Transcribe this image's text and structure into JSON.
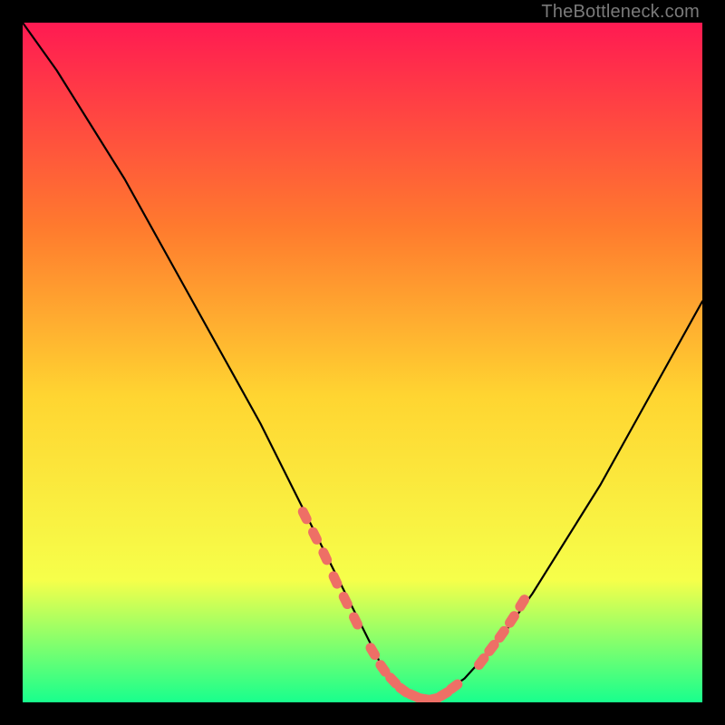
{
  "watermark": "TheBottleneck.com",
  "chart_data": {
    "type": "line",
    "title": "",
    "xlabel": "",
    "ylabel": "",
    "xlim": [
      0,
      100
    ],
    "ylim": [
      0,
      100
    ],
    "grid": false,
    "legend": false,
    "series": [
      {
        "name": "curve",
        "color": "#000000",
        "x": [
          0,
          5,
          10,
          15,
          20,
          25,
          30,
          35,
          40,
          45,
          50,
          52.5,
          55,
          57.5,
          60,
          65,
          70,
          75,
          80,
          85,
          90,
          95,
          100
        ],
        "values": [
          100,
          93,
          85,
          77,
          68,
          59,
          50,
          41,
          31,
          21,
          11,
          6,
          3,
          1,
          0,
          3.5,
          9,
          16,
          24,
          32,
          41,
          50,
          59
        ]
      }
    ],
    "highlight_segments": [
      {
        "name": "left-approach",
        "points": [
          {
            "x": 41.5,
            "y": 27.5
          },
          {
            "x": 43.0,
            "y": 24.5
          },
          {
            "x": 44.5,
            "y": 21.5
          },
          {
            "x": 46.0,
            "y": 18.0
          },
          {
            "x": 47.5,
            "y": 15.0
          },
          {
            "x": 49.0,
            "y": 12.0
          }
        ]
      },
      {
        "name": "valley-floor",
        "points": [
          {
            "x": 51.5,
            "y": 7.5
          },
          {
            "x": 53.0,
            "y": 5.0
          },
          {
            "x": 54.5,
            "y": 3.2
          },
          {
            "x": 56.0,
            "y": 1.8
          },
          {
            "x": 57.5,
            "y": 1.0
          },
          {
            "x": 59.0,
            "y": 0.5
          },
          {
            "x": 60.5,
            "y": 0.5
          },
          {
            "x": 62.0,
            "y": 1.2
          },
          {
            "x": 63.5,
            "y": 2.3
          }
        ]
      },
      {
        "name": "right-rise",
        "points": [
          {
            "x": 67.5,
            "y": 6.0
          },
          {
            "x": 69.0,
            "y": 8.0
          },
          {
            "x": 70.5,
            "y": 10.0
          },
          {
            "x": 72.0,
            "y": 12.2
          },
          {
            "x": 73.5,
            "y": 14.6
          }
        ]
      }
    ],
    "background_gradient": {
      "top": "#ff1a52",
      "upper": "#ff7a2e",
      "mid": "#ffd531",
      "lower": "#f6ff4a",
      "bottom": "#18ff8d"
    },
    "highlight_color": "#ee6f66"
  }
}
